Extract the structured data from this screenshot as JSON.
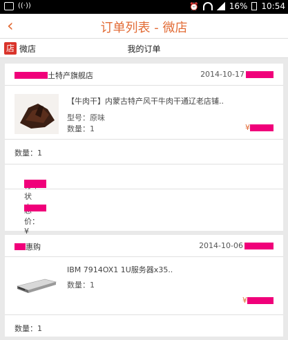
{
  "status_bar": {
    "battery": "16%",
    "time": "10:54"
  },
  "header": {
    "title": "订单列表 - 微店"
  },
  "subheader": {
    "badge": "店",
    "shop": "微店",
    "title": "我的订单"
  },
  "orders": [
    {
      "store_suffix": "土特产旗舰店",
      "date": "2014-10-17",
      "product_title": "【牛肉干】内蒙古特产风干牛肉干通辽老店铺..",
      "model": "型号：原味",
      "qty_line": "数量：1",
      "price_symbol": "¥",
      "summary_qty": "数量：1",
      "status_label": "订单状态：",
      "total_label": "总价：¥"
    },
    {
      "store_suffix": "惠购",
      "date": "2014-10-06",
      "product_title": "IBM 7914OX1 1U服务器x35..",
      "qty_line": "数量：1",
      "price_symbol": "¥",
      "summary_qty": "数量：1"
    }
  ],
  "colors": {
    "accent": "#e26b35",
    "redaction": "#f0007a",
    "badge": "#d9342b"
  }
}
